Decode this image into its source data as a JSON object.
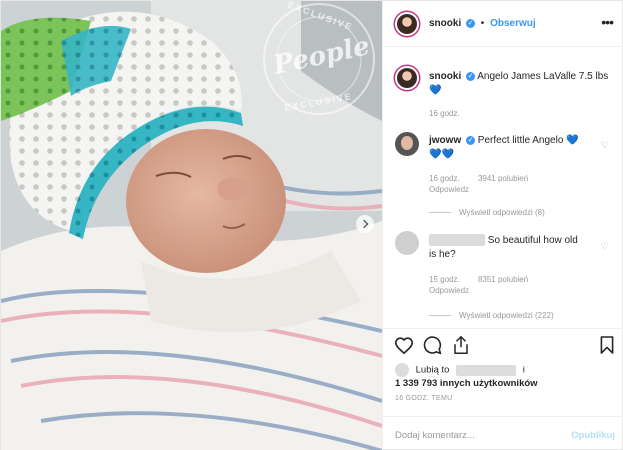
{
  "header": {
    "username": "snooki",
    "separator": "•",
    "follow_label": "Obserwuj",
    "more_label": "•••"
  },
  "caption": {
    "username": "snooki",
    "text": "Angelo James LaValle 7.5 lbs",
    "emoji": "💙",
    "time": "16 godz."
  },
  "comments": [
    {
      "username": "jwoww",
      "text": "Perfect little Angelo 💙",
      "emoji": "💙💙",
      "time": "16 godz.",
      "likes": "3941 polubień",
      "reply": "Odpowiedz",
      "view_replies": "Wyświetl odpowiedzi (8)"
    },
    {
      "username": "",
      "text": "So beautiful how old",
      "text2": "is he?",
      "time": "15 godz.",
      "likes": "8351 polubień",
      "reply": "Odpowiedz",
      "view_replies": "Wyświetl odpowiedzi (222)"
    }
  ],
  "likes": {
    "prefix": "Lubią to",
    "suffix": "i",
    "count_line": "1 339 793 innych użytkowników"
  },
  "timestamp": "16 GODZ. TEMU",
  "add_comment": {
    "placeholder": "Dodaj komentarz...",
    "publish": "Opublikuj"
  },
  "watermark": {
    "text": "People",
    "ring": "EXCLUSIVE"
  },
  "icons": [
    "heart-icon",
    "comment-icon",
    "share-icon",
    "bookmark-icon",
    "more-icon",
    "verified-icon"
  ],
  "colors": {
    "link_blue": "#3897f0",
    "muted": "#999999",
    "publish_disabled": "#b2dffc",
    "hat_teal": "#2bb0bf",
    "hat_green": "#6cbf4a"
  }
}
